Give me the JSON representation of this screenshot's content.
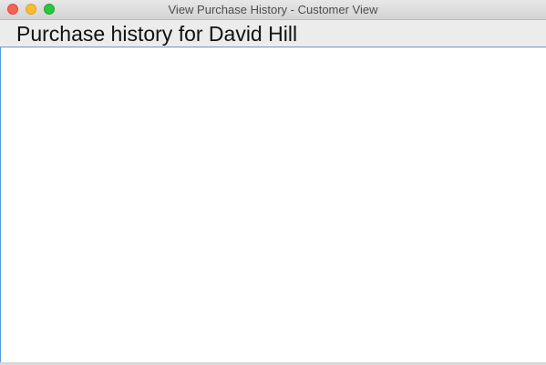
{
  "window": {
    "title": "View Purchase History - Customer View"
  },
  "header": {
    "title": "Purchase history for David Hill"
  },
  "colors": {
    "close": "#fc5f57",
    "minimize": "#fdbc2e",
    "zoom": "#28c840",
    "focus_border": "#5b9bd5"
  }
}
